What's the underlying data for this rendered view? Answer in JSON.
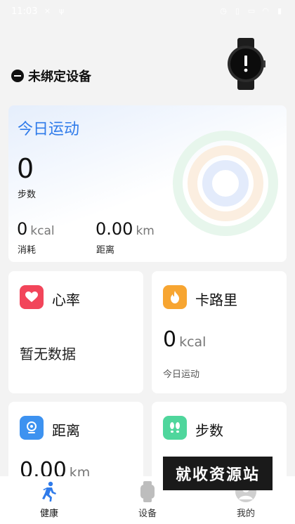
{
  "status_bar": {
    "time": "11:03",
    "left_icons": [
      "close-icon",
      "usb-icon"
    ],
    "right_icons": [
      "alarm-icon",
      "vibrate-icon",
      "sim-icon",
      "wifi-icon",
      "battery-icon"
    ]
  },
  "device": {
    "label": "未绑定设备"
  },
  "today": {
    "title": "今日运动",
    "steps_value": "0",
    "steps_label": "步数",
    "kcal_value": "0",
    "kcal_unit": "kcal",
    "kcal_label": "消耗",
    "distance_value": "0.00",
    "distance_unit": "km",
    "distance_label": "距离"
  },
  "cards": {
    "heart_rate": {
      "title": "心率",
      "value": "暂无数据",
      "icon": "heart-icon",
      "color": "#f2455a"
    },
    "calories": {
      "title": "卡路里",
      "value": "0",
      "unit": "kcal",
      "subtitle": "今日运动",
      "icon": "flame-icon",
      "color": "#f7a531"
    },
    "distance": {
      "title": "距离",
      "value": "0.00",
      "unit": "km",
      "icon": "location-icon",
      "color": "#3d92f0"
    },
    "steps": {
      "title": "步数",
      "icon": "footprint-icon",
      "color": "#4fd69c"
    }
  },
  "nav": {
    "items": [
      {
        "label": "健康",
        "icon": "run-icon",
        "active": true
      },
      {
        "label": "设备",
        "icon": "watch-icon",
        "active": false
      },
      {
        "label": "我的",
        "icon": "person-icon",
        "active": false
      }
    ]
  },
  "watermark": {
    "text": "就收资源站"
  },
  "colors": {
    "accent_blue": "#2f7bea",
    "ring_outer": "#e7f6ec",
    "ring_middle": "#fbeee0",
    "ring_inner": "#e3ebfb"
  }
}
